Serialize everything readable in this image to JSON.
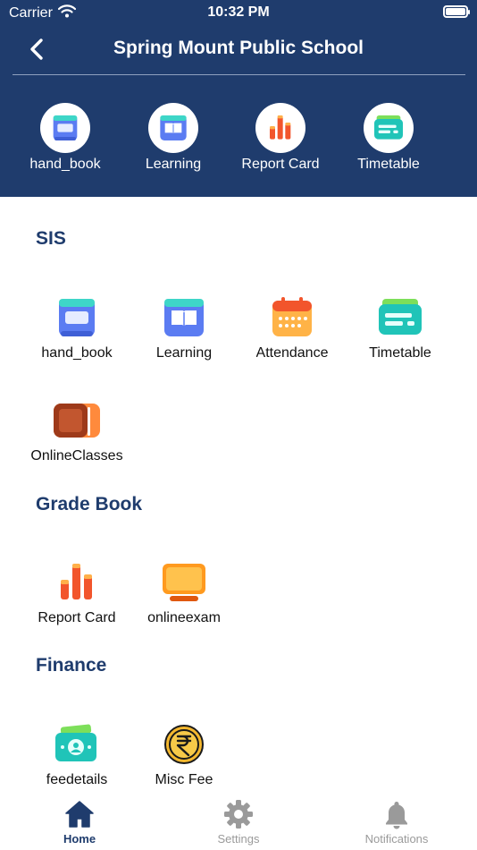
{
  "status_bar": {
    "carrier": "Carrier",
    "time": "10:32 PM"
  },
  "nav": {
    "title": "Spring Mount Public School",
    "back_icon": "chevron-left-icon"
  },
  "quick_links": [
    {
      "label": "hand_book",
      "icon": "handbook-icon"
    },
    {
      "label": "Learning",
      "icon": "book-icon"
    },
    {
      "label": "Report Card",
      "icon": "bar-chart-icon"
    },
    {
      "label": "Timetable",
      "icon": "timetable-card-icon"
    }
  ],
  "sections": {
    "sis": {
      "title": "SIS",
      "items": [
        {
          "label": "hand_book",
          "icon": "handbook-icon"
        },
        {
          "label": "Learning",
          "icon": "book-icon"
        },
        {
          "label": "Attendance",
          "icon": "calendar-icon"
        },
        {
          "label": "Timetable",
          "icon": "timetable-card-icon"
        },
        {
          "label": "OnlineClasses",
          "icon": "tv-icon"
        }
      ]
    },
    "grade_book": {
      "title": "Grade Book",
      "items": [
        {
          "label": "Report Card",
          "icon": "bar-chart-icon"
        },
        {
          "label": "onlineexam",
          "icon": "monitor-icon"
        }
      ]
    },
    "finance": {
      "title": "Finance",
      "items": [
        {
          "label": "feedetails",
          "icon": "money-icon"
        },
        {
          "label": "Misc Fee",
          "icon": "rupee-coin-icon"
        }
      ]
    }
  },
  "tabbar": {
    "tabs": [
      {
        "label": "Home",
        "icon": "home-icon",
        "active": true
      },
      {
        "label": "Settings",
        "icon": "gear-icon",
        "active": false
      },
      {
        "label": "Notifications",
        "icon": "bell-icon",
        "active": false
      }
    ]
  },
  "colors": {
    "primary": "#1f3c6d",
    "inactive": "#9a9a9a"
  }
}
